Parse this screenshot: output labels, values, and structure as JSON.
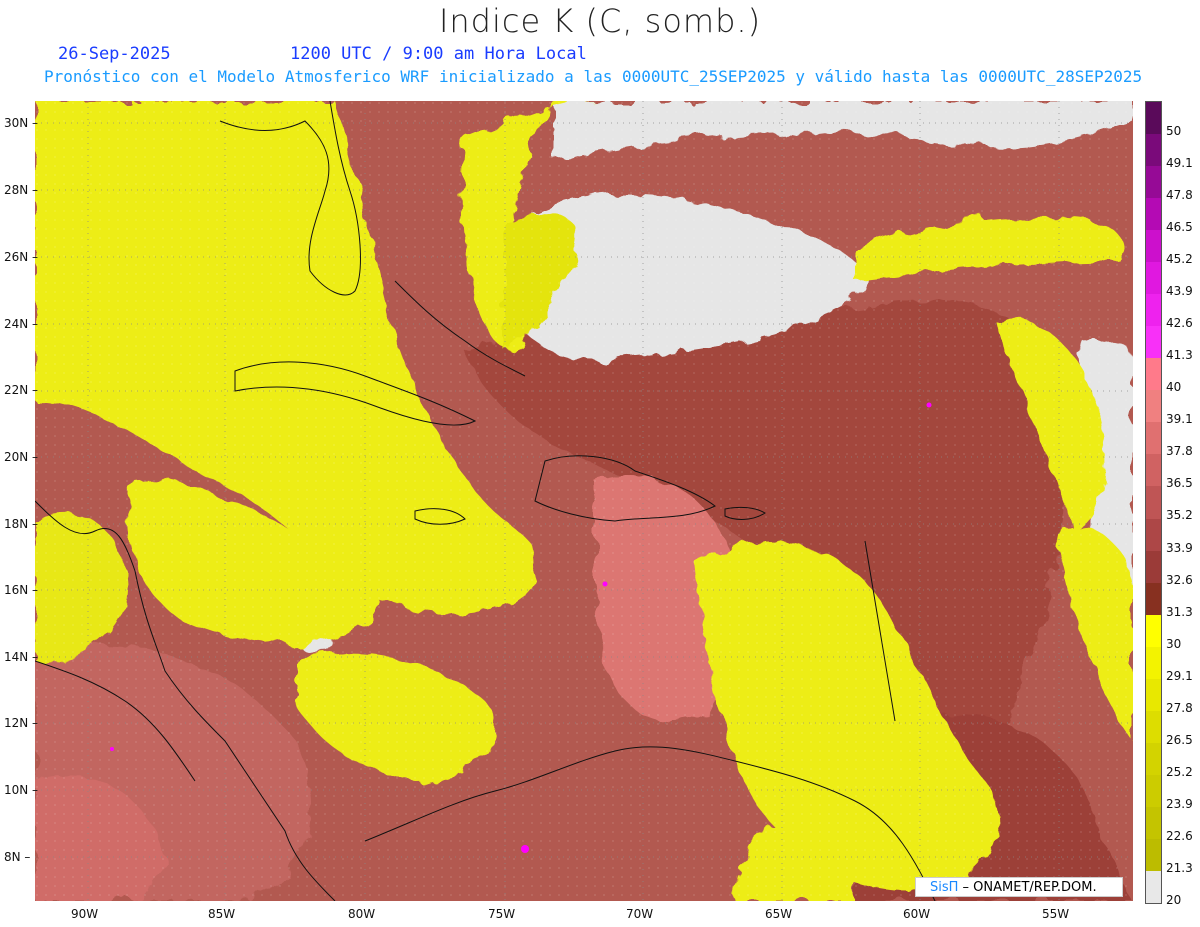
{
  "title": "Indice K (C, somb.)",
  "date": "26-Sep-2025",
  "valid_time": "1200 UTC / 9:00 am Hora Local",
  "model_line": "Pronóstico con el Modelo Atmosferico WRF inicializado a las 0000UTC_25SEP2025 y válido hasta las  0000UTC_28SEP2025",
  "lat_labels": [
    "30N",
    "28N",
    "26N",
    "24N",
    "22N",
    "20N",
    "18N",
    "16N",
    "14N",
    "12N",
    "10N",
    "8N"
  ],
  "lon_labels": [
    "90W",
    "85W",
    "80W",
    "75W",
    "70W",
    "65W",
    "60W",
    "55W"
  ],
  "colorbar": {
    "labels": [
      "50",
      "49.1",
      "47.8",
      "46.5",
      "45.2",
      "43.9",
      "42.6",
      "41.3",
      "40",
      "39.1",
      "37.8",
      "36.5",
      "35.2",
      "33.9",
      "32.6",
      "31.3",
      "30",
      "29.1",
      "27.8",
      "26.5",
      "25.2",
      "23.9",
      "22.6",
      "21.3",
      "20"
    ],
    "colors": [
      "#5a0a5a",
      "#7a0a7a",
      "#960a96",
      "#b40ab4",
      "#cc10cc",
      "#e018e0",
      "#ee22ee",
      "#f830f8",
      "#ff7a8a",
      "#f08080",
      "#e07070",
      "#d06262",
      "#bf5555",
      "#ad4747",
      "#9b3b38",
      "#873020",
      "#ffff00",
      "#f3f300",
      "#e8e800",
      "#dddd00",
      "#d3d300",
      "#cccc00",
      "#c4c400",
      "#bcbc00",
      "#e8e8e8"
    ]
  },
  "credit": {
    "logo": "SisΠ",
    "text": " – ONAMET/REP.DOM."
  },
  "colors": {
    "high_k": "#b85a50",
    "mid_k": "#a84840",
    "peak_k": "#e07a78",
    "low_k": "#eeee10",
    "none": "#e6e6e6"
  }
}
